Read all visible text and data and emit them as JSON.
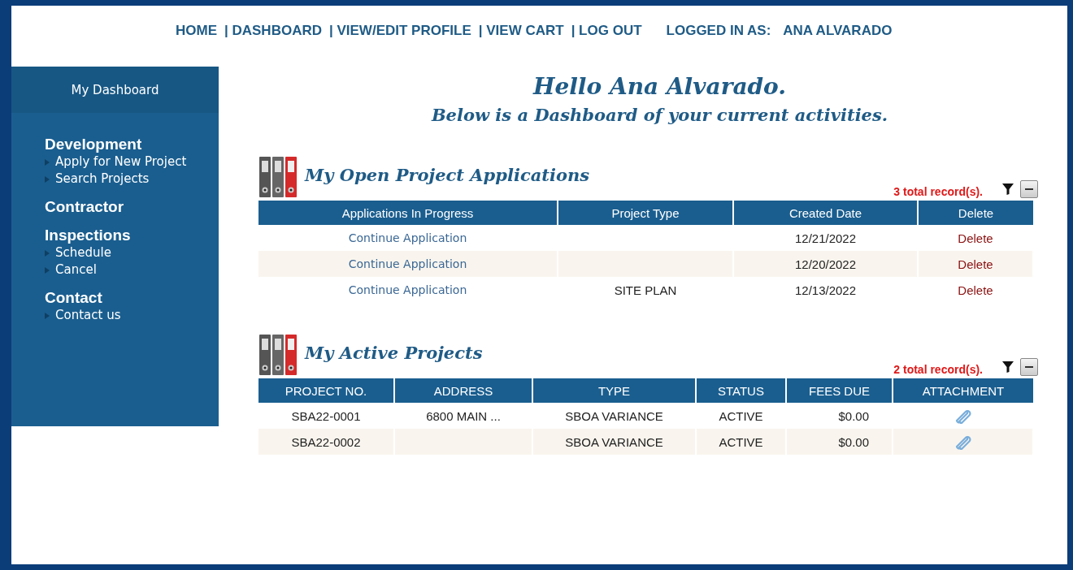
{
  "nav": {
    "links": [
      "HOME",
      "| DASHBOARD",
      "| VIEW/EDIT PROFILE",
      "| VIEW CART",
      "| LOG OUT"
    ],
    "logged_in_label": "LOGGED IN AS:",
    "user": "ANA ALVARADO"
  },
  "sidebar": {
    "header": "My Dashboard",
    "sections": [
      {
        "title": "Development",
        "links": [
          "Apply for New Project",
          "Search Projects"
        ]
      },
      {
        "title": "Contractor"
      },
      {
        "title": "Inspections",
        "links": [
          "Schedule",
          "Cancel"
        ]
      },
      {
        "title": "Contact",
        "links": [
          "Contact us"
        ]
      }
    ]
  },
  "greeting": "Hello Ana Alvarado.",
  "subtitle": "Below is a Dashboard of your current activities.",
  "panels": [
    {
      "title": "My Open Project Applications",
      "records": "3 total record(s).",
      "kind": "applications",
      "columns": [
        "Applications In Progress",
        "Project Type",
        "Created Date",
        "Delete"
      ],
      "rows": [
        {
          "cells": [
            "Continue Application",
            "",
            "12/21/2022",
            "Delete"
          ]
        },
        {
          "cells": [
            "Continue Application",
            "",
            "12/20/2022",
            "Delete"
          ]
        },
        {
          "cells": [
            "Continue Application",
            "SITE PLAN",
            "12/13/2022",
            "Delete"
          ]
        }
      ]
    },
    {
      "title": "My Active Projects",
      "records": "2 total record(s).",
      "kind": "projects",
      "columns": [
        "PROJECT NO.",
        "ADDRESS",
        "TYPE",
        "STATUS",
        "FEES DUE",
        "ATTACHMENT"
      ],
      "rows": [
        {
          "cells": [
            "SBA22-0001",
            "6800 MAIN ...",
            "SBOA VARIANCE",
            "ACTIVE",
            "$0.00"
          ],
          "attachment": true
        },
        {
          "cells": [
            "SBA22-0002",
            "",
            "SBOA VARIANCE",
            "ACTIVE",
            "$0.00"
          ],
          "attachment": true
        }
      ]
    }
  ]
}
